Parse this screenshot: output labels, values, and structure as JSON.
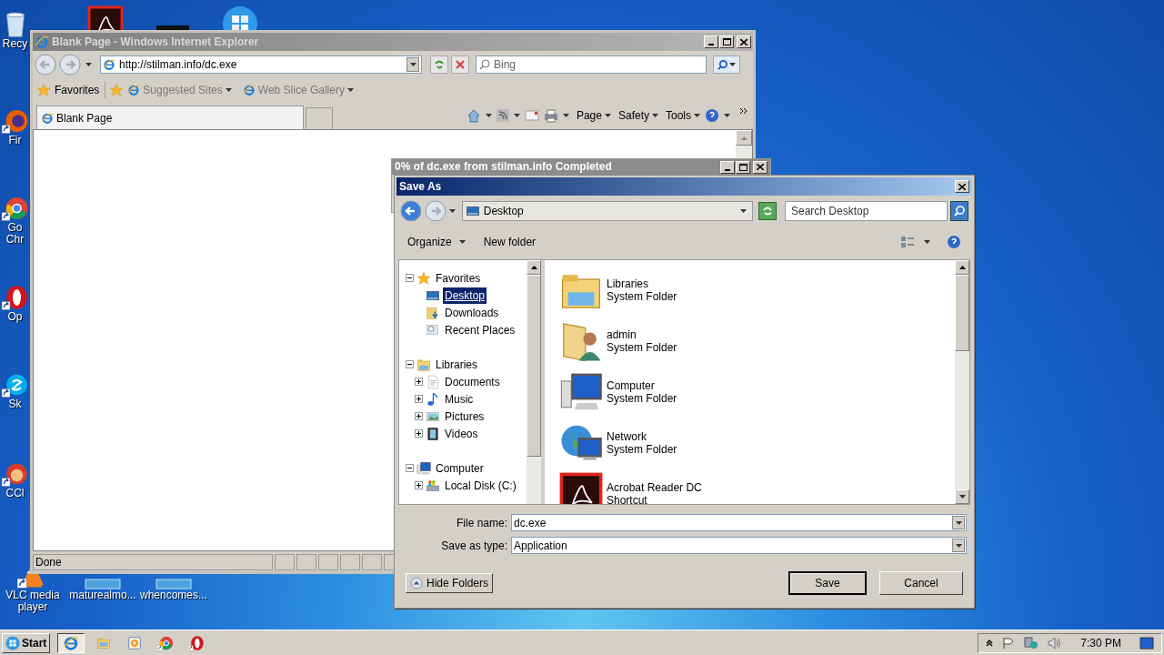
{
  "desktop_icons": [
    {
      "kind": "recycle",
      "lines": [
        "Recy"
      ]
    },
    {
      "kind": "acrobat"
    },
    {
      "kind": "dark"
    },
    {
      "kind": "windows"
    },
    {
      "kind": "firefox",
      "lines": [
        "Fir"
      ]
    },
    {
      "kind": "chrome",
      "lines": [
        "Go",
        "Chr"
      ]
    },
    {
      "kind": "opera",
      "lines": [
        "Op"
      ]
    },
    {
      "kind": "skype",
      "lines": [
        "Sk"
      ]
    },
    {
      "kind": "ccleaner",
      "lines": [
        "CCl"
      ]
    },
    {
      "kind": "vlc",
      "lines": [
        "VLC media",
        "player"
      ]
    },
    {
      "kind": "thumb",
      "lines": [
        "maturealmo..."
      ]
    },
    {
      "kind": "thumb",
      "lines": [
        "whencomes..."
      ]
    }
  ],
  "ie_window": {
    "title": "Blank Page - Windows Internet Explorer",
    "address": "http://stilman.info/dc.exe",
    "search_placeholder": "Bing",
    "favorites_label": "Favorites",
    "favorites_links": [
      "Suggested Sites",
      "Web Slice Gallery"
    ],
    "tab": "Blank Page",
    "commands": [
      "Page",
      "Safety",
      "Tools"
    ],
    "status": "Done"
  },
  "download_window": {
    "title": "0% of dc.exe from stilman.info Completed"
  },
  "save_as": {
    "title": "Save As",
    "location": "Desktop",
    "search_placeholder": "Search Desktop",
    "toolbar": [
      "Organize",
      "New folder"
    ],
    "tree": [
      {
        "label": "Favorites",
        "kind": "star",
        "expanded": true,
        "selected": false,
        "children": [
          {
            "label": "Desktop",
            "kind": "desktop",
            "selected": true
          },
          {
            "label": "Downloads",
            "kind": "downloads",
            "selected": false
          },
          {
            "label": "Recent Places",
            "kind": "recent",
            "selected": false
          }
        ]
      },
      {
        "label": "Libraries",
        "kind": "library",
        "expanded": true,
        "selected": false,
        "children": [
          {
            "label": "Documents",
            "kind": "document",
            "expanded": false,
            "selected": false
          },
          {
            "label": "Music",
            "kind": "music",
            "expanded": false,
            "selected": false
          },
          {
            "label": "Pictures",
            "kind": "pictures",
            "expanded": false,
            "selected": false
          },
          {
            "label": "Videos",
            "kind": "videos",
            "expanded": false,
            "selected": false
          }
        ]
      },
      {
        "label": "Computer",
        "kind": "computer",
        "expanded": true,
        "selected": false,
        "children": [
          {
            "label": "Local Disk (C:)",
            "kind": "disk",
            "expanded": false,
            "selected": false
          }
        ]
      }
    ],
    "files": [
      {
        "name": "Libraries",
        "type": "System Folder",
        "kind": "library"
      },
      {
        "name": "admin",
        "type": "System Folder",
        "kind": "user"
      },
      {
        "name": "Computer",
        "type": "System Folder",
        "kind": "computer"
      },
      {
        "name": "Network",
        "type": "System Folder",
        "kind": "network"
      },
      {
        "name": "Acrobat Reader DC",
        "type": "Shortcut",
        "kind": "acrobat"
      }
    ],
    "file_name_label": "File name:",
    "file_name": "dc.exe",
    "type_label": "Save as type:",
    "type_value": "Application",
    "hide_folders": "Hide Folders",
    "save": "Save",
    "cancel": "Cancel"
  },
  "taskbar": {
    "start": "Start",
    "apps": [
      {
        "kind": "ie",
        "selected": true
      },
      {
        "kind": "explorer",
        "selected": false
      },
      {
        "kind": "media",
        "selected": false
      },
      {
        "kind": "chrome",
        "selected": false
      },
      {
        "kind": "opera",
        "selected": false
      }
    ],
    "clock": "7:30 PM"
  }
}
